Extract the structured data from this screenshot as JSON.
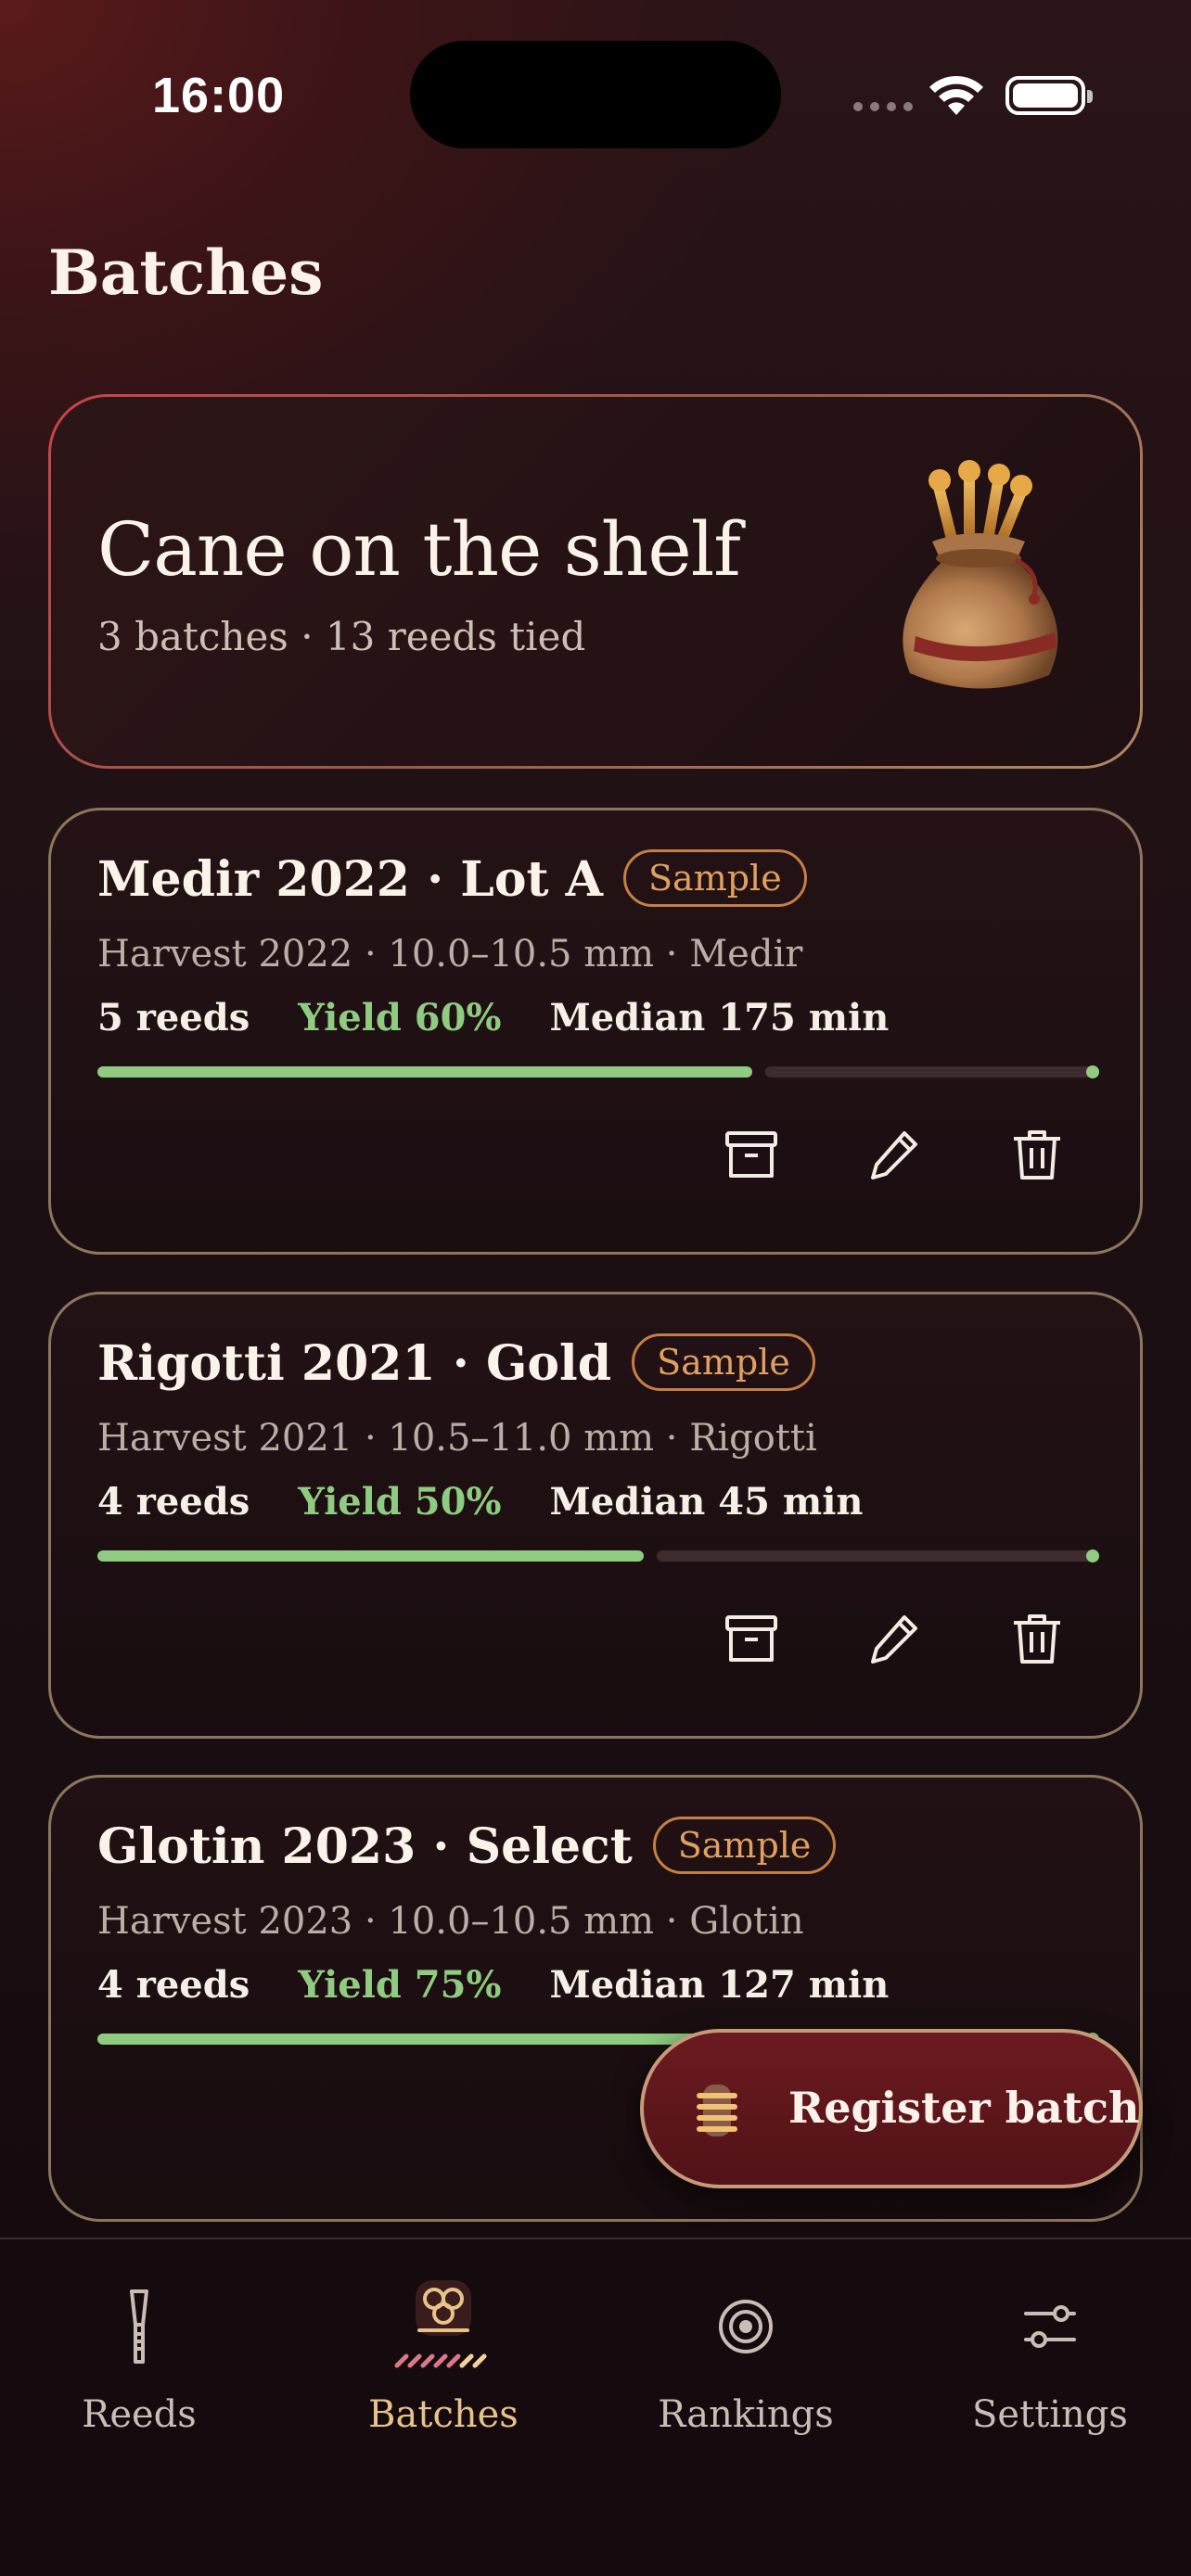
{
  "status_bar": {
    "time": "16:00"
  },
  "page": {
    "title": "Batches"
  },
  "summary": {
    "title": "Cane on the shelf",
    "subtitle": "3 batches · 13 reeds tied"
  },
  "batches": [
    {
      "title": "Medir 2022 · Lot A",
      "badge": "Sample",
      "meta": "Harvest 2022 · 10.0–10.5 mm · Medir",
      "reeds": "5 reeds",
      "yield": "Yield 60%",
      "median": "Median 175 min",
      "progress": 0.6
    },
    {
      "title": "Rigotti 2021 · Gold",
      "badge": "Sample",
      "meta": "Harvest 2021 · 10.5–11.0 mm · Rigotti",
      "reeds": "4 reeds",
      "yield": "Yield 50%",
      "median": "Median 45 min",
      "progress": 0.5
    },
    {
      "title": "Glotin 2023 · Select",
      "badge": "Sample",
      "meta": "Harvest 2023 · 10.0–10.5 mm · Glotin",
      "reeds": "4 reeds",
      "yield": "Yield 75%",
      "median": "Median 127 min",
      "progress": 0.75
    }
  ],
  "fab": {
    "label": "Register batch"
  },
  "tabs": [
    {
      "label": "Reeds",
      "icon": "reed-icon",
      "active": false
    },
    {
      "label": "Batches",
      "icon": "batches-icon",
      "active": true
    },
    {
      "label": "Rankings",
      "icon": "target-icon",
      "active": false
    },
    {
      "label": "Settings",
      "icon": "sliders-icon",
      "active": false
    }
  ],
  "colors": {
    "accent_green": "#8fcb80",
    "badge_orange": "#e0a061",
    "active_tab": "#e7c28a",
    "fab_bg": "#6b1b20"
  }
}
